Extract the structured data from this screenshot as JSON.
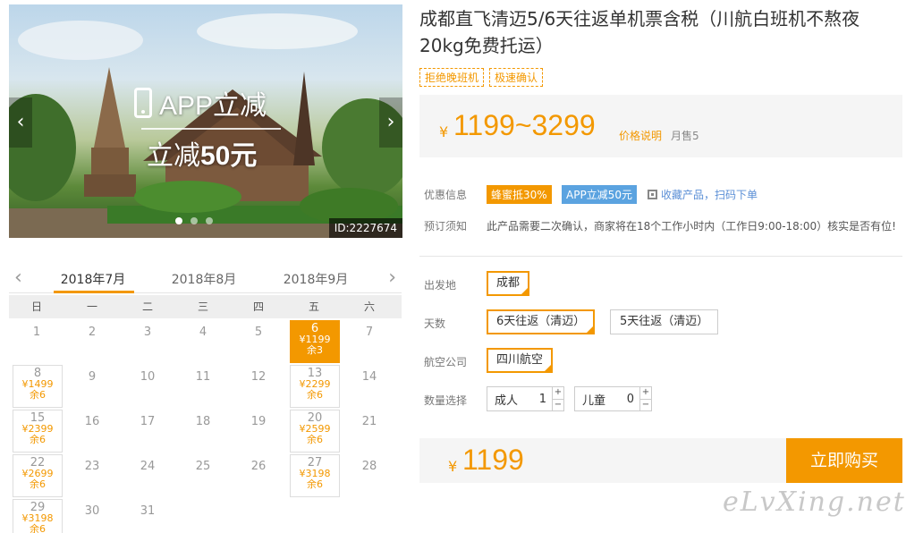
{
  "hero": {
    "promo_line1": "APP立减",
    "promo_line2_prefix": "立减",
    "promo_line2_amount": "50元",
    "image_id": "ID:2227674",
    "prev_arrow": "‹",
    "next_arrow": "›"
  },
  "calendar": {
    "prev": "‹",
    "next": "›",
    "months": [
      "2018年7月",
      "2018年8月",
      "2018年9月"
    ],
    "weekdays": [
      "日",
      "一",
      "二",
      "三",
      "四",
      "五",
      "六"
    ],
    "days": [
      {
        "d": "1"
      },
      {
        "d": "2"
      },
      {
        "d": "3"
      },
      {
        "d": "4"
      },
      {
        "d": "5"
      },
      {
        "d": "6",
        "price": "¥1199",
        "left": "余3",
        "selected": true
      },
      {
        "d": "7"
      },
      {
        "d": "8",
        "price": "¥1499",
        "left": "余6"
      },
      {
        "d": "9"
      },
      {
        "d": "10"
      },
      {
        "d": "11"
      },
      {
        "d": "12"
      },
      {
        "d": "13",
        "price": "¥2299",
        "left": "余6"
      },
      {
        "d": "14"
      },
      {
        "d": "15",
        "price": "¥2399",
        "left": "余6"
      },
      {
        "d": "16"
      },
      {
        "d": "17"
      },
      {
        "d": "18"
      },
      {
        "d": "19"
      },
      {
        "d": "20",
        "price": "¥2599",
        "left": "余6"
      },
      {
        "d": "21"
      },
      {
        "d": "22",
        "price": "¥2699",
        "left": "余6"
      },
      {
        "d": "23"
      },
      {
        "d": "24"
      },
      {
        "d": "25"
      },
      {
        "d": "26"
      },
      {
        "d": "27",
        "price": "¥3198",
        "left": "余6"
      },
      {
        "d": "28"
      },
      {
        "d": "29",
        "price": "¥3198",
        "left": "余6"
      },
      {
        "d": "30"
      },
      {
        "d": "31"
      }
    ]
  },
  "product": {
    "title": "成都直飞清迈5/6天往返单机票含税（川航白班机不熬夜20kg免费托运）",
    "tags": [
      "拒绝晚班机",
      "极速确认"
    ],
    "currency": "¥",
    "price_range": "1199~3299",
    "price_explain": "价格说明",
    "monthly_sales": "月售5"
  },
  "info": {
    "discount_label": "优惠信息",
    "badge_honey": "蜂蜜抵30%",
    "badge_app": "APP立减50元",
    "favorite_text": "收藏产品，扫码下单",
    "notice_label": "预订须知",
    "notice_text": "此产品需要二次确认，商家将在18个工作小时内（工作日9:00-18:00）核实是否有位!"
  },
  "options": {
    "departure_label": "出发地",
    "departure_value": "成都",
    "days_label": "天数",
    "days_options": [
      "6天往返（清迈）",
      "5天往返（清迈）"
    ],
    "airline_label": "航空公司",
    "airline_value": "四川航空",
    "qty_label": "数量选择",
    "adult_label": "成人",
    "adult_value": "1",
    "child_label": "儿童",
    "child_value": "0",
    "plus": "+",
    "minus": "−"
  },
  "checkout": {
    "currency": "¥",
    "total": "1199",
    "buy_label": "立即购买"
  },
  "watermark": "eLvXing.net",
  "colors": {
    "accent": "#f39800",
    "blue_badge": "#5ba3e0",
    "link": "#5b8fd6"
  }
}
